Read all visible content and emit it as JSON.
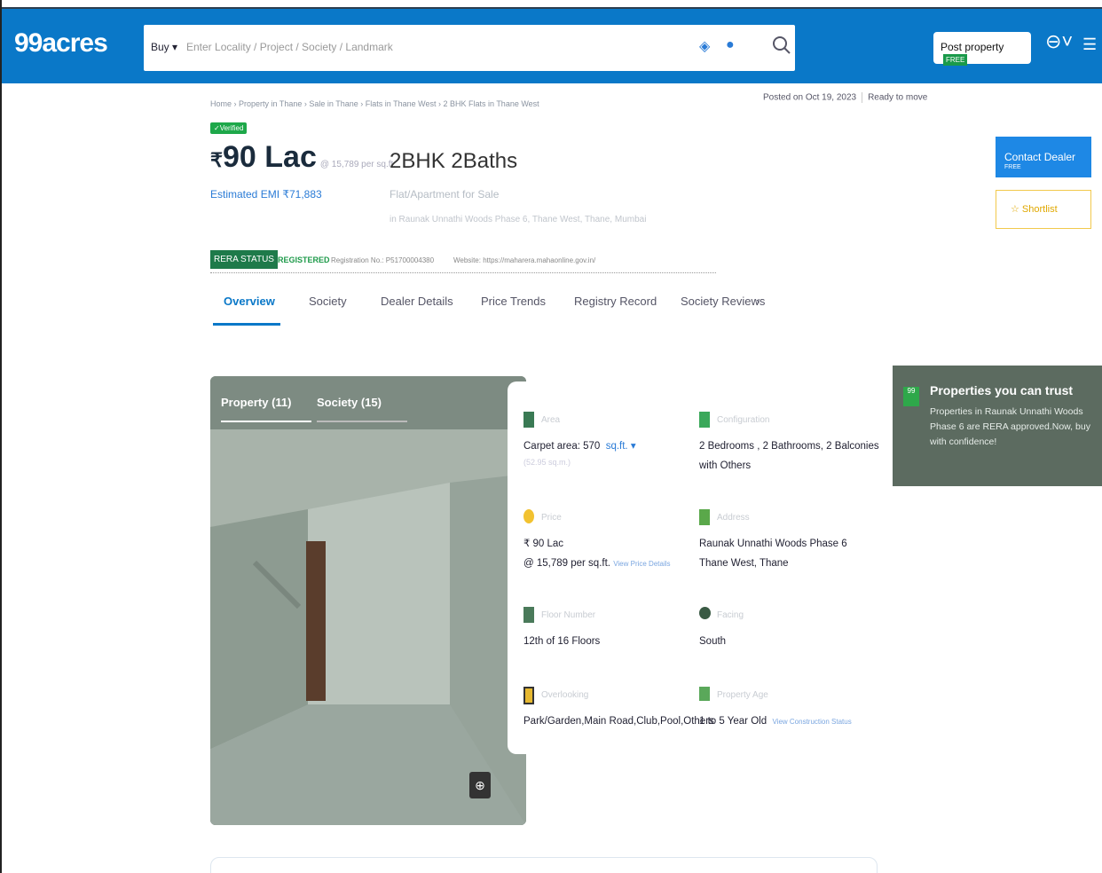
{
  "header": {
    "logo": "99acres",
    "search": {
      "buy_label": "Buy ▾",
      "placeholder": "Enter Locality / Project / Society / Landmark"
    },
    "post_property": {
      "label": "Post property",
      "badge": "FREE"
    },
    "icons": [
      "location-icon",
      "mic-icon",
      "search-icon",
      "user-icon",
      "menu-icon"
    ]
  },
  "listing": {
    "breadcrumb": "Home › Property in Thane › Sale in Thane › Flats in Thane West › 2 BHK Flats in Thane West",
    "posted_on": "Posted on Oct 19, 2023",
    "status": "Ready to move",
    "verified": "✓Verified",
    "price": "90 Lac",
    "price_currency": "₹",
    "price_per_sqft": "@ 15,789 per sq.ft.",
    "emi": "Estimated EMI ₹71,883",
    "bhk": "2BHK 2Baths",
    "subtype": "Flat/Apartment for Sale",
    "address_line": "in Raunak Unnathi Woods Phase 6, Thane West, Thane, Mumbai",
    "contact_button": "Contact Dealer",
    "contact_badge": "FREE",
    "shortlist_button": "☆ Shortlist"
  },
  "rera": {
    "badge": "RERA STATUS",
    "registered": "REGISTERED",
    "registration": "Registration No.: P51700004380",
    "website": "Website: https://maharera.mahaonline.gov.in/"
  },
  "tabs": [
    "Overview",
    "Society",
    "Dealer Details",
    "Price Trends",
    "Registry Record",
    "Society Reviews"
  ],
  "gallery": {
    "tab_property": "Property (11)",
    "tab_society": "Society (15)"
  },
  "details": {
    "area": {
      "label": "Area",
      "value": "Carpet area: 570",
      "unit": "sq.ft. ▾",
      "sub": "(52.95 sq.m.)"
    },
    "configuration": {
      "label": "Configuration",
      "line1": "2 Bedrooms , 2 Bathrooms, 2 Balconies",
      "line2": "with Others"
    },
    "price": {
      "label": "Price",
      "line1": "₹ 90 Lac",
      "line2": "@ 15,789 per sq.ft.",
      "link": "View Price Details"
    },
    "address": {
      "label": "Address",
      "line1": "Raunak Unnathi Woods Phase 6",
      "line2": "Thane West, Thane"
    },
    "floor": {
      "label": "Floor Number",
      "value": "12th  of 16 Floors"
    },
    "facing": {
      "label": "Facing",
      "value": "South"
    },
    "overlooking": {
      "label": "Overlooking",
      "value": "Park/Garden,Main Road,Club,Pool,Others"
    },
    "age": {
      "label": "Property Age",
      "value": "1 to 5 Year Old",
      "link": "View Construction Status"
    }
  },
  "trust": {
    "title": "Properties you can trust",
    "description": "Properties in Raunak Unnathi Woods Phase 6 are RERA approved.Now, buy with confidence!"
  },
  "colors": {
    "brand": "#0a78c8",
    "rera_green": "#1e7a4a",
    "trust_bg": "#5c6b60",
    "shortlist": "#f2c94c"
  }
}
